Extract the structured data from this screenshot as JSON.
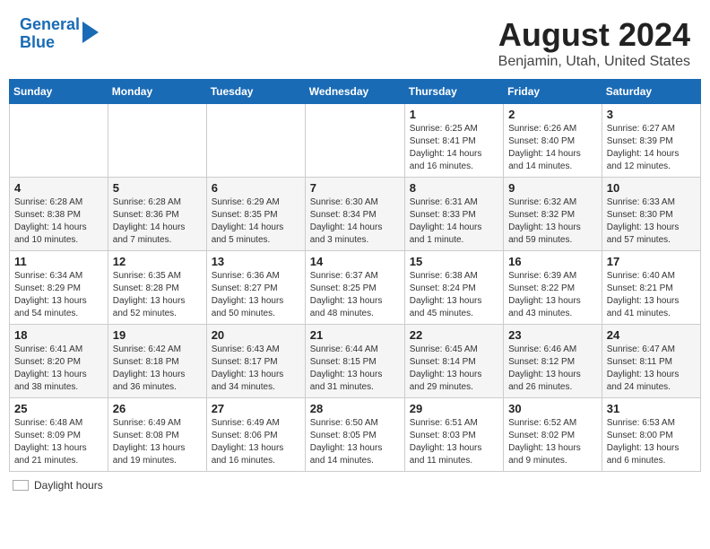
{
  "header": {
    "logo_line1": "General",
    "logo_line2": "Blue",
    "title": "August 2024",
    "subtitle": "Benjamin, Utah, United States"
  },
  "days_of_week": [
    "Sunday",
    "Monday",
    "Tuesday",
    "Wednesday",
    "Thursday",
    "Friday",
    "Saturday"
  ],
  "weeks": [
    [
      {
        "num": "",
        "info": ""
      },
      {
        "num": "",
        "info": ""
      },
      {
        "num": "",
        "info": ""
      },
      {
        "num": "",
        "info": ""
      },
      {
        "num": "1",
        "info": "Sunrise: 6:25 AM\nSunset: 8:41 PM\nDaylight: 14 hours and 16 minutes."
      },
      {
        "num": "2",
        "info": "Sunrise: 6:26 AM\nSunset: 8:40 PM\nDaylight: 14 hours and 14 minutes."
      },
      {
        "num": "3",
        "info": "Sunrise: 6:27 AM\nSunset: 8:39 PM\nDaylight: 14 hours and 12 minutes."
      }
    ],
    [
      {
        "num": "4",
        "info": "Sunrise: 6:28 AM\nSunset: 8:38 PM\nDaylight: 14 hours and 10 minutes."
      },
      {
        "num": "5",
        "info": "Sunrise: 6:28 AM\nSunset: 8:36 PM\nDaylight: 14 hours and 7 minutes."
      },
      {
        "num": "6",
        "info": "Sunrise: 6:29 AM\nSunset: 8:35 PM\nDaylight: 14 hours and 5 minutes."
      },
      {
        "num": "7",
        "info": "Sunrise: 6:30 AM\nSunset: 8:34 PM\nDaylight: 14 hours and 3 minutes."
      },
      {
        "num": "8",
        "info": "Sunrise: 6:31 AM\nSunset: 8:33 PM\nDaylight: 14 hours and 1 minute."
      },
      {
        "num": "9",
        "info": "Sunrise: 6:32 AM\nSunset: 8:32 PM\nDaylight: 13 hours and 59 minutes."
      },
      {
        "num": "10",
        "info": "Sunrise: 6:33 AM\nSunset: 8:30 PM\nDaylight: 13 hours and 57 minutes."
      }
    ],
    [
      {
        "num": "11",
        "info": "Sunrise: 6:34 AM\nSunset: 8:29 PM\nDaylight: 13 hours and 54 minutes."
      },
      {
        "num": "12",
        "info": "Sunrise: 6:35 AM\nSunset: 8:28 PM\nDaylight: 13 hours and 52 minutes."
      },
      {
        "num": "13",
        "info": "Sunrise: 6:36 AM\nSunset: 8:27 PM\nDaylight: 13 hours and 50 minutes."
      },
      {
        "num": "14",
        "info": "Sunrise: 6:37 AM\nSunset: 8:25 PM\nDaylight: 13 hours and 48 minutes."
      },
      {
        "num": "15",
        "info": "Sunrise: 6:38 AM\nSunset: 8:24 PM\nDaylight: 13 hours and 45 minutes."
      },
      {
        "num": "16",
        "info": "Sunrise: 6:39 AM\nSunset: 8:22 PM\nDaylight: 13 hours and 43 minutes."
      },
      {
        "num": "17",
        "info": "Sunrise: 6:40 AM\nSunset: 8:21 PM\nDaylight: 13 hours and 41 minutes."
      }
    ],
    [
      {
        "num": "18",
        "info": "Sunrise: 6:41 AM\nSunset: 8:20 PM\nDaylight: 13 hours and 38 minutes."
      },
      {
        "num": "19",
        "info": "Sunrise: 6:42 AM\nSunset: 8:18 PM\nDaylight: 13 hours and 36 minutes."
      },
      {
        "num": "20",
        "info": "Sunrise: 6:43 AM\nSunset: 8:17 PM\nDaylight: 13 hours and 34 minutes."
      },
      {
        "num": "21",
        "info": "Sunrise: 6:44 AM\nSunset: 8:15 PM\nDaylight: 13 hours and 31 minutes."
      },
      {
        "num": "22",
        "info": "Sunrise: 6:45 AM\nSunset: 8:14 PM\nDaylight: 13 hours and 29 minutes."
      },
      {
        "num": "23",
        "info": "Sunrise: 6:46 AM\nSunset: 8:12 PM\nDaylight: 13 hours and 26 minutes."
      },
      {
        "num": "24",
        "info": "Sunrise: 6:47 AM\nSunset: 8:11 PM\nDaylight: 13 hours and 24 minutes."
      }
    ],
    [
      {
        "num": "25",
        "info": "Sunrise: 6:48 AM\nSunset: 8:09 PM\nDaylight: 13 hours and 21 minutes."
      },
      {
        "num": "26",
        "info": "Sunrise: 6:49 AM\nSunset: 8:08 PM\nDaylight: 13 hours and 19 minutes."
      },
      {
        "num": "27",
        "info": "Sunrise: 6:49 AM\nSunset: 8:06 PM\nDaylight: 13 hours and 16 minutes."
      },
      {
        "num": "28",
        "info": "Sunrise: 6:50 AM\nSunset: 8:05 PM\nDaylight: 13 hours and 14 minutes."
      },
      {
        "num": "29",
        "info": "Sunrise: 6:51 AM\nSunset: 8:03 PM\nDaylight: 13 hours and 11 minutes."
      },
      {
        "num": "30",
        "info": "Sunrise: 6:52 AM\nSunset: 8:02 PM\nDaylight: 13 hours and 9 minutes."
      },
      {
        "num": "31",
        "info": "Sunrise: 6:53 AM\nSunset: 8:00 PM\nDaylight: 13 hours and 6 minutes."
      }
    ]
  ],
  "footer": {
    "label": "Daylight hours"
  }
}
